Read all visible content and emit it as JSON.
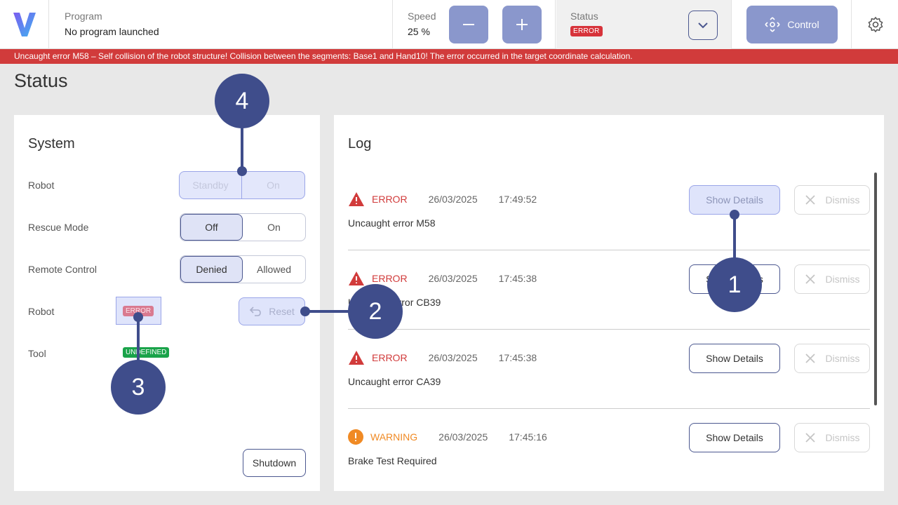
{
  "topbar": {
    "program_label": "Program",
    "program_value": "No program launched",
    "speed_label": "Speed",
    "speed_value": "25 %",
    "status_label": "Status",
    "status_badge": "ERROR",
    "control_label": "Control"
  },
  "error_banner": "Uncaught error M58 – Self collision of the robot structure! Collision between the segments: Base1 and Hand10! The error occurred in the target coordinate calculation.",
  "page_title": "Status",
  "system": {
    "title": "System",
    "robot_label": "Robot",
    "robot_options": [
      "Standby",
      "On"
    ],
    "rescue_label": "Rescue Mode",
    "rescue_options": [
      "Off",
      "On"
    ],
    "remote_label": "Remote Control",
    "remote_options": [
      "Denied",
      "Allowed"
    ],
    "robot_state_label": "Robot",
    "robot_state_badge": "ERROR",
    "reset_label": "Reset",
    "tool_label": "Tool",
    "tool_badge": "UNDEFINED",
    "shutdown_label": "Shutdown"
  },
  "log": {
    "title": "Log",
    "show_details": "Show Details",
    "dismiss": "Dismiss",
    "entries": [
      {
        "level": "ERROR",
        "date": "26/03/2025",
        "time": "17:49:52",
        "message": "Uncaught error M58"
      },
      {
        "level": "ERROR",
        "date": "26/03/2025",
        "time": "17:45:38",
        "message": "Uncaught error CB39"
      },
      {
        "level": "ERROR",
        "date": "26/03/2025",
        "time": "17:45:38",
        "message": "Uncaught error CA39"
      },
      {
        "level": "WARNING",
        "date": "26/03/2025",
        "time": "17:45:16",
        "message": "Brake Test Required"
      }
    ]
  },
  "callouts": [
    "1",
    "2",
    "3",
    "4"
  ],
  "colors": {
    "accent": "#3f4d8b",
    "error": "#d13b3b",
    "warning": "#f08a24",
    "success": "#1aa34a"
  }
}
